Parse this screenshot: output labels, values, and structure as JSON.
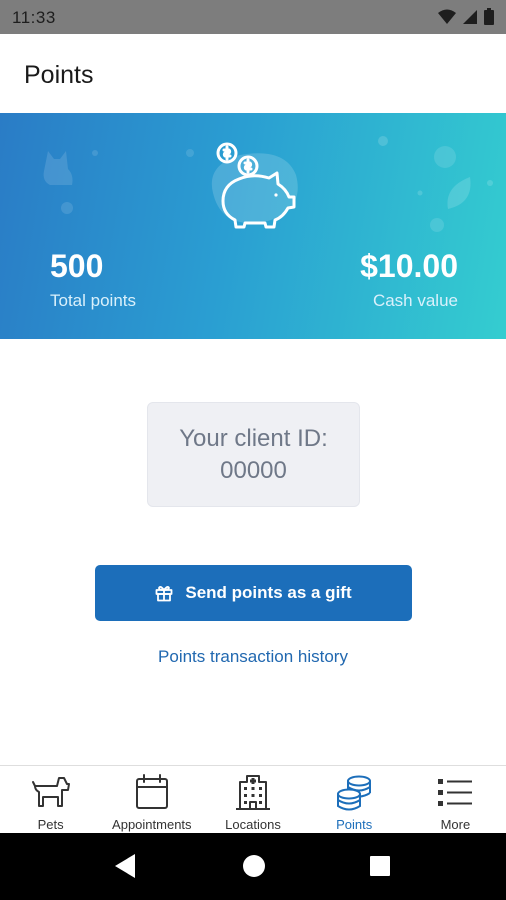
{
  "status_bar": {
    "time": "11:33"
  },
  "header": {
    "title": "Points"
  },
  "banner": {
    "total_points_value": "500",
    "total_points_label": "Total points",
    "cash_value_value": "$10.00",
    "cash_value_label": "Cash value"
  },
  "client": {
    "line1": "Your client ID:",
    "line2": "00000"
  },
  "actions": {
    "gift_button_label": "Send points as a gift",
    "history_link": "Points transaction history"
  },
  "bottom_nav": {
    "items": [
      {
        "label": "Pets",
        "icon": "dog-icon"
      },
      {
        "label": "Appointments",
        "icon": "calendar-icon"
      },
      {
        "label": "Locations",
        "icon": "building-icon"
      },
      {
        "label": "Points",
        "icon": "coins-icon",
        "active": true
      },
      {
        "label": "More",
        "icon": "list-icon"
      }
    ]
  },
  "colors": {
    "accent": "#1c6eba",
    "banner_start": "#2a7cc6",
    "banner_end": "#34cdd0",
    "card_bg": "#eff0f4"
  }
}
